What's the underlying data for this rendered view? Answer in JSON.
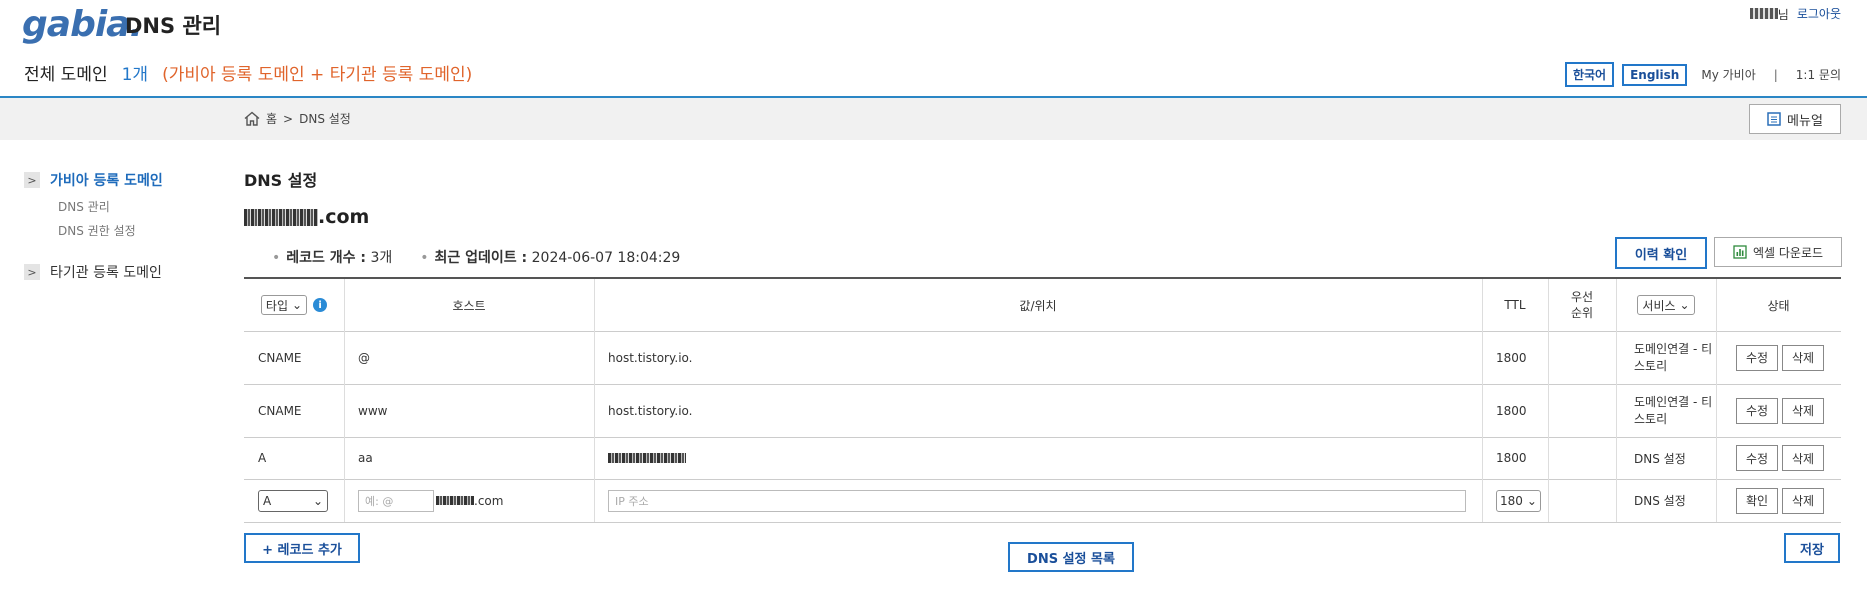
{
  "header": {
    "logo_text": "gabia",
    "logo_dot": ".",
    "app_title": "DNS 관리",
    "user_suffix": "님",
    "logout": "로그아웃"
  },
  "summary": {
    "label": "전체 도메인",
    "count": "1개",
    "note": "(가비아 등록 도메인 + 타기관 등록 도메인)"
  },
  "lang": {
    "korean": "한국어",
    "english": "English",
    "my_gabia": "My 가비아",
    "separator": "|",
    "inquiry": "1:1 문의"
  },
  "breadcrumb": {
    "home": "홈",
    "arrow": ">",
    "current": "DNS 설정"
  },
  "manual_button": "메뉴얼",
  "sidebar": {
    "group1": {
      "arrow": ">",
      "label": "가비아 등록 도메인"
    },
    "sub_items": [
      "DNS 관리",
      "DNS 권한 설정"
    ],
    "group2": {
      "arrow": ">",
      "label": "타기관 등록 도메인"
    }
  },
  "main": {
    "title": "DNS 설정",
    "domain_suffix": ".com",
    "record_count_label": "레코드 개수 :",
    "record_count": "3개",
    "last_update_label": "최근 업데이트 :",
    "last_update": "2024-06-07 18:04:29",
    "history_button": "이력 확인",
    "excel_button": "엑셀 다운로드"
  },
  "table": {
    "headers": {
      "type_select": "타입",
      "info": "i",
      "host": "호스트",
      "value": "값/위치",
      "ttl": "TTL",
      "priority": "우선\n순위",
      "service_select": "서비스",
      "status": "상태"
    },
    "rows": [
      {
        "type": "CNAME",
        "host": "@",
        "value": "host.tistory.io.",
        "ttl": "1800",
        "priority": "",
        "service": "도메인연결 - 티스토리",
        "btn1": "수정",
        "btn2": "삭제"
      },
      {
        "type": "CNAME",
        "host": "www",
        "value": "host.tistory.io.",
        "ttl": "1800",
        "priority": "",
        "service": "도메인연결 - 티스토리",
        "btn1": "수정",
        "btn2": "삭제"
      },
      {
        "type": "A",
        "host": "aa",
        "value": "",
        "ttl": "1800",
        "priority": "",
        "service": "DNS 설정",
        "btn1": "수정",
        "btn2": "삭제"
      }
    ],
    "new_row": {
      "type": "A",
      "host_placeholder": "예: @",
      "host_suffix": ".com",
      "value_placeholder": "IP 주소",
      "ttl": "180",
      "service": "DNS 설정",
      "btn1": "확인",
      "btn2": "삭제"
    }
  },
  "footer": {
    "add_record": "+ 레코드 추가",
    "dns_list": "DNS 설정 목록",
    "save": "저장"
  }
}
